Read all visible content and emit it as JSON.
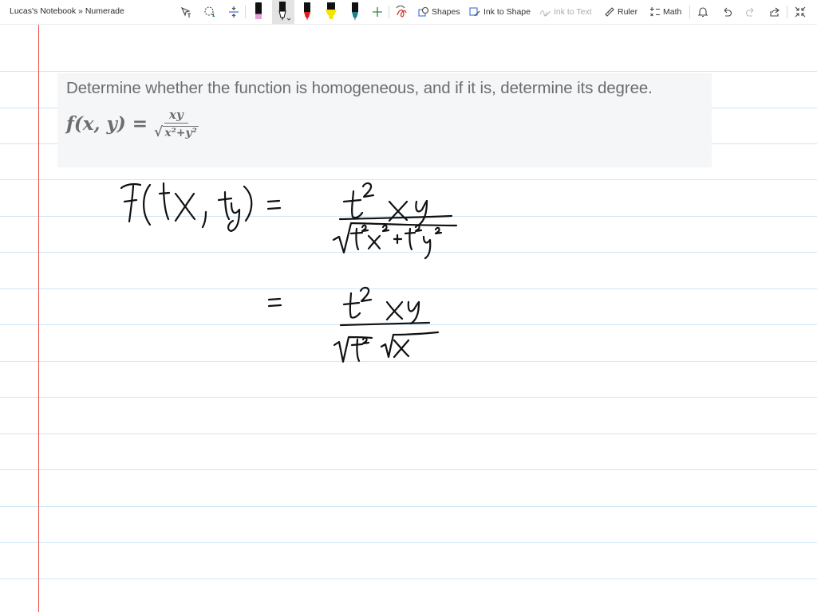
{
  "breadcrumb": "Lucas's Notebook » Numerade",
  "toolbar": {
    "tools": [
      {
        "icon": "lasso-select-text-icon"
      },
      {
        "icon": "lasso-select-icon"
      },
      {
        "icon": "insert-space-icon"
      }
    ],
    "pens": [
      {
        "icon": "pen-icon",
        "color": "#e8a0d6",
        "selected": false
      },
      {
        "icon": "pen-icon",
        "color": "#111111",
        "selected": true
      },
      {
        "icon": "pen-icon",
        "color": "#e01b1b",
        "selected": false
      },
      {
        "icon": "highlighter-icon",
        "color": "#f4e400",
        "selected": false
      },
      {
        "icon": "pen-icon",
        "color": "#1a7f86",
        "selected": false
      }
    ],
    "add_pen_icon": "plus-icon",
    "ink_replay_icon": "ink-replay-icon",
    "shapes_label": "Shapes",
    "ink_to_shape_label": "Ink to Shape",
    "ink_to_text_label": "Ink to Text",
    "ruler_label": "Ruler",
    "math_label": "Math",
    "right_icons": [
      "bell-icon",
      "undo-icon",
      "redo-icon",
      "share-icon",
      "collapse-icon"
    ]
  },
  "problem": {
    "text": "Determine whether the function is homogeneous, and if it is, determine its degree.",
    "formula_lhs": "f(x, y) =",
    "formula_numerator": "xy",
    "formula_radical": "√",
    "formula_denominator": "x²+y²"
  },
  "colors": {
    "accent_ink": "#111111",
    "margin_line": "#f04a4a",
    "rule_line": "#cde6f5",
    "problem_bg": "#f5f6f7",
    "problem_text": "#6d6d6d"
  }
}
